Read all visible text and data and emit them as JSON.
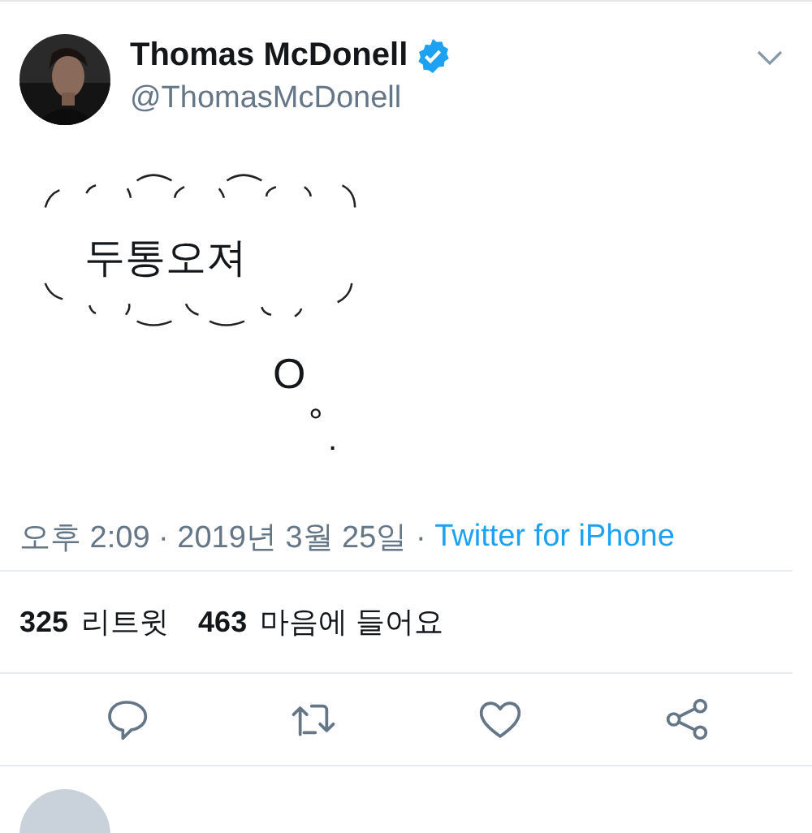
{
  "tweet": {
    "author": {
      "name": "Thomas McDonell",
      "verified": true,
      "handle": "@ThomasMcDonell"
    },
    "cloud_text": "두통오져",
    "bubbles": [
      "O",
      "°",
      "."
    ],
    "timestamp": "오후 2:09 · 2019년 3월 25일 · ",
    "source": "Twitter for iPhone",
    "stats": [
      {
        "count": "325",
        "label": "리트윗"
      },
      {
        "count": "463",
        "label": "마음에 들어요"
      }
    ],
    "actions": [
      {
        "kind": "reply"
      },
      {
        "kind": "retweet"
      },
      {
        "kind": "like"
      },
      {
        "kind": "share"
      }
    ]
  }
}
